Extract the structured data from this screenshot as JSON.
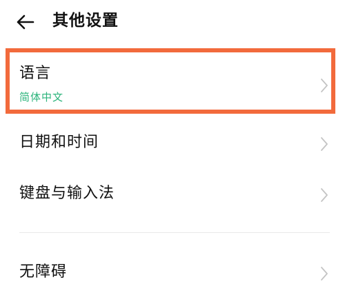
{
  "header": {
    "title": "其他设置",
    "back_icon": "arrow-left-icon"
  },
  "settings": {
    "language": {
      "label": "语言",
      "value": "简体中文"
    },
    "date_time": {
      "label": "日期和时间"
    },
    "keyboard": {
      "label": "键盘与输入法"
    },
    "accessibility": {
      "label": "无障碍"
    }
  },
  "colors": {
    "highlight": "#f26a3c",
    "value_text": "#2ab37a",
    "chevron": "#c4c4c4"
  }
}
